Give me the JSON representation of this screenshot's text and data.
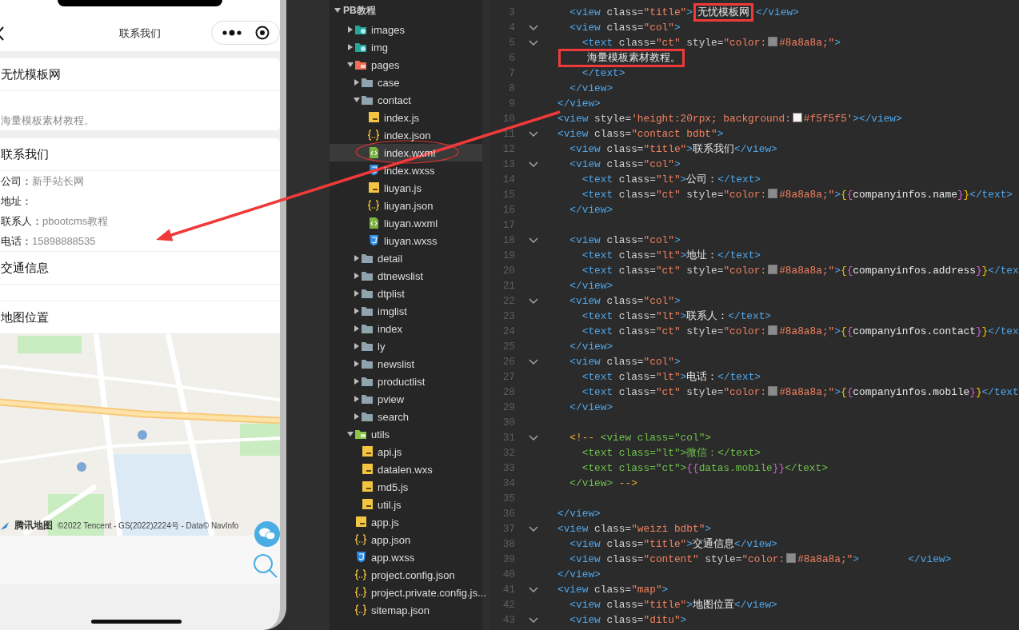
{
  "phone": {
    "nav_title": "联系我们",
    "intro": {
      "title": "无忧模板网",
      "text": "海量模板素材教程。"
    },
    "contact": {
      "title": "联系我们",
      "rows": [
        {
          "label": "公司：",
          "value": "新手站长网"
        },
        {
          "label": "地址："
        },
        {
          "label": "联系人：",
          "value": "pbootcms教程"
        },
        {
          "label": "电话：",
          "value": "15898888535"
        }
      ]
    },
    "traffic": {
      "title": "交通信息"
    },
    "map_section": {
      "title": "地图位置",
      "map": {
        "kind": "picture",
        "logo": "腾讯地图",
        "attribution": "©2022 Tencent - GS(2022)2224号 - Data© NavInfo"
      }
    }
  },
  "file_tree": {
    "title": "PB教程",
    "expanded": true,
    "items": [
      {
        "label": "images",
        "kind": "assets",
        "expanded": false,
        "selected": false
      },
      {
        "label": "img",
        "kind": "assets",
        "expanded": false,
        "selected": false
      },
      {
        "label": "pages",
        "kind": "pages",
        "expanded": true,
        "selected": false,
        "children": [
          {
            "label": "case",
            "kind": "folder",
            "expanded": false,
            "selected": false
          },
          {
            "label": "contact",
            "kind": "folder",
            "expanded": true,
            "selected": false,
            "children": [
              {
                "label": "index.js",
                "kind": "js",
                "selected": false
              },
              {
                "label": "index.json",
                "kind": "json",
                "selected": false
              },
              {
                "label": "index.wxml",
                "kind": "wxml",
                "selected": true
              },
              {
                "label": "index.wxss",
                "kind": "wxss",
                "selected": false
              },
              {
                "label": "liuyan.js",
                "kind": "js",
                "selected": false
              },
              {
                "label": "liuyan.json",
                "kind": "json",
                "selected": false
              },
              {
                "label": "liuyan.wxml",
                "kind": "wxml",
                "selected": false
              },
              {
                "label": "liuyan.wxss",
                "kind": "wxss",
                "selected": false
              }
            ]
          },
          {
            "label": "detail",
            "kind": "folder",
            "expanded": false,
            "selected": false
          },
          {
            "label": "dtnewslist",
            "kind": "folder",
            "expanded": false,
            "selected": false
          },
          {
            "label": "dtplist",
            "kind": "folder",
            "expanded": false,
            "selected": false
          },
          {
            "label": "imglist",
            "kind": "folder",
            "expanded": false,
            "selected": false
          },
          {
            "label": "index",
            "kind": "folder",
            "expanded": false,
            "selected": false
          },
          {
            "label": "ly",
            "kind": "folder",
            "expanded": false,
            "selected": false
          },
          {
            "label": "newslist",
            "kind": "folder",
            "expanded": false,
            "selected": false
          },
          {
            "label": "productlist",
            "kind": "folder",
            "expanded": false,
            "selected": false
          },
          {
            "label": "pview",
            "kind": "folder",
            "expanded": false,
            "selected": false
          },
          {
            "label": "search",
            "kind": "folder",
            "expanded": false,
            "selected": false
          }
        ]
      },
      {
        "label": "utils",
        "kind": "utils",
        "expanded": true,
        "selected": false,
        "children": [
          {
            "label": "api.js",
            "kind": "js",
            "selected": false
          },
          {
            "label": "datalen.wxs",
            "kind": "js",
            "selected": false
          },
          {
            "label": "md5.js",
            "kind": "js",
            "selected": false
          },
          {
            "label": "util.js",
            "kind": "js",
            "selected": false
          }
        ]
      },
      {
        "label": "app.js",
        "kind": "js",
        "selected": false
      },
      {
        "label": "app.json",
        "kind": "json",
        "selected": false
      },
      {
        "label": "app.wxss",
        "kind": "wxss",
        "selected": false
      },
      {
        "label": "project.config.json",
        "kind": "json",
        "selected": false
      },
      {
        "label": "project.private.config.js...",
        "kind": "json",
        "selected": false
      },
      {
        "label": "sitemap.json",
        "kind": "json",
        "selected": false
      }
    ]
  },
  "editor": {
    "lines": [
      {
        "number": "3",
        "fold": false,
        "tokens": [
          {
            "kind": "tag",
            "text": "  <view"
          },
          {
            "kind": "attr",
            "text": " class="
          },
          {
            "kind": "string",
            "text": "\"title\""
          },
          {
            "kind": "tag",
            "text": ">"
          },
          {
            "kind": "text",
            "text": "无忧模板网",
            "highlighted": true
          },
          {
            "kind": "tag",
            "text": "</view>"
          }
        ]
      },
      {
        "number": "4",
        "fold": true,
        "tokens": [
          {
            "kind": "tag",
            "text": "  <view"
          },
          {
            "kind": "attr",
            "text": " class="
          },
          {
            "kind": "string",
            "text": "\"col\""
          },
          {
            "kind": "tag",
            "text": ">"
          }
        ]
      },
      {
        "number": "5",
        "fold": true,
        "tokens": [
          {
            "kind": "tag",
            "text": "    <text"
          },
          {
            "kind": "attr",
            "text": " class="
          },
          {
            "kind": "string",
            "text": "\"ct\""
          },
          {
            "kind": "attr",
            "text": " style="
          },
          {
            "kind": "string",
            "text": "\"color:"
          },
          {
            "kind": "swatch",
            "color": "#8a8a8a"
          },
          {
            "kind": "string",
            "text": "#8a8a8a;\""
          },
          {
            "kind": "tag",
            "text": ">"
          }
        ]
      },
      {
        "number": "6",
        "fold": false,
        "tokens": [
          {
            "kind": "text",
            "text": "    海量模板素材教程。",
            "highlighted": true
          }
        ]
      },
      {
        "number": "7",
        "fold": false,
        "tokens": [
          {
            "kind": "tag",
            "text": "    </text>"
          }
        ]
      },
      {
        "number": "8",
        "fold": false,
        "tokens": [
          {
            "kind": "tag",
            "text": "  </view>"
          }
        ]
      },
      {
        "number": "9",
        "fold": false,
        "tokens": [
          {
            "kind": "tag",
            "text": "</view>"
          }
        ]
      },
      {
        "number": "10",
        "fold": false,
        "tokens": [
          {
            "kind": "tag",
            "text": "<view"
          },
          {
            "kind": "attr",
            "text": " style="
          },
          {
            "kind": "string",
            "text": "'height:20rpx; background:"
          },
          {
            "kind": "swatch",
            "color": "#f5f5f5"
          },
          {
            "kind": "string",
            "text": "#f5f5f5'"
          },
          {
            "kind": "tag",
            "text": "></view>"
          }
        ]
      },
      {
        "number": "11",
        "fold": true,
        "tokens": [
          {
            "kind": "tag",
            "text": "<view"
          },
          {
            "kind": "attr",
            "text": " class="
          },
          {
            "kind": "string",
            "text": "\"contact bdbt\""
          },
          {
            "kind": "tag",
            "text": ">"
          }
        ]
      },
      {
        "number": "12",
        "fold": false,
        "tokens": [
          {
            "kind": "tag",
            "text": "  <view"
          },
          {
            "kind": "attr",
            "text": " class="
          },
          {
            "kind": "string",
            "text": "\"title\""
          },
          {
            "kind": "tag",
            "text": ">"
          },
          {
            "kind": "text",
            "text": "联系我们"
          },
          {
            "kind": "tag",
            "text": "</view>"
          }
        ]
      },
      {
        "number": "13",
        "fold": true,
        "tokens": [
          {
            "kind": "tag",
            "text": "  <view"
          },
          {
            "kind": "attr",
            "text": " class="
          },
          {
            "kind": "string",
            "text": "\"col\""
          },
          {
            "kind": "tag",
            "text": ">"
          }
        ]
      },
      {
        "number": "14",
        "fold": false,
        "tokens": [
          {
            "kind": "tag",
            "text": "    <text"
          },
          {
            "kind": "attr",
            "text": " class="
          },
          {
            "kind": "string",
            "text": "\"lt\""
          },
          {
            "kind": "tag",
            "text": ">"
          },
          {
            "kind": "text",
            "text": "公司："
          },
          {
            "kind": "tag",
            "text": "</text>"
          }
        ]
      },
      {
        "number": "15",
        "fold": false,
        "tokens": [
          {
            "kind": "tag",
            "text": "    <text"
          },
          {
            "kind": "attr",
            "text": " class="
          },
          {
            "kind": "string",
            "text": "\"ct\""
          },
          {
            "kind": "attr",
            "text": " style="
          },
          {
            "kind": "string",
            "text": "\"color:"
          },
          {
            "kind": "swatch",
            "color": "#8a8a8a"
          },
          {
            "kind": "string",
            "text": "#8a8a8a;\""
          },
          {
            "kind": "tag",
            "text": ">"
          },
          {
            "kind": "brace",
            "text": "{"
          },
          {
            "kind": "brace2",
            "text": "{"
          },
          {
            "kind": "text",
            "text": "companyinfos.name"
          },
          {
            "kind": "brace2",
            "text": "}"
          },
          {
            "kind": "brace",
            "text": "}"
          },
          {
            "kind": "tag",
            "text": "</text>"
          }
        ]
      },
      {
        "number": "16",
        "fold": false,
        "tokens": [
          {
            "kind": "tag",
            "text": "  </view>"
          }
        ]
      },
      {
        "number": "17",
        "fold": false
      },
      {
        "number": "18",
        "fold": true,
        "tokens": [
          {
            "kind": "tag",
            "text": "  <view"
          },
          {
            "kind": "attr",
            "text": " class="
          },
          {
            "kind": "string",
            "text": "\"col\""
          },
          {
            "kind": "tag",
            "text": ">"
          }
        ]
      },
      {
        "number": "19",
        "fold": false,
        "tokens": [
          {
            "kind": "tag",
            "text": "    <text"
          },
          {
            "kind": "attr",
            "text": " class="
          },
          {
            "kind": "string",
            "text": "\"lt\""
          },
          {
            "kind": "tag",
            "text": ">"
          },
          {
            "kind": "text",
            "text": "地址："
          },
          {
            "kind": "tag",
            "text": "</text>"
          }
        ]
      },
      {
        "number": "20",
        "fold": false,
        "tokens": [
          {
            "kind": "tag",
            "text": "    <text"
          },
          {
            "kind": "attr",
            "text": " class="
          },
          {
            "kind": "string",
            "text": "\"ct\""
          },
          {
            "kind": "attr",
            "text": " style="
          },
          {
            "kind": "string",
            "text": "\"color:"
          },
          {
            "kind": "swatch",
            "color": "#8a8a8a"
          },
          {
            "kind": "string",
            "text": "#8a8a8a;\""
          },
          {
            "kind": "tag",
            "text": ">"
          },
          {
            "kind": "brace",
            "text": "{"
          },
          {
            "kind": "brace2",
            "text": "{"
          },
          {
            "kind": "text",
            "text": "companyinfos.address"
          },
          {
            "kind": "brace2",
            "text": "}"
          },
          {
            "kind": "brace",
            "text": "}"
          },
          {
            "kind": "tag",
            "text": "</tex"
          }
        ]
      },
      {
        "number": "21",
        "fold": false,
        "tokens": [
          {
            "kind": "tag",
            "text": "  </view>"
          }
        ]
      },
      {
        "number": "22",
        "fold": true,
        "tokens": [
          {
            "kind": "tag",
            "text": "  <view"
          },
          {
            "kind": "attr",
            "text": " class="
          },
          {
            "kind": "string",
            "text": "\"col\""
          },
          {
            "kind": "tag",
            "text": ">"
          }
        ]
      },
      {
        "number": "23",
        "fold": false,
        "tokens": [
          {
            "kind": "tag",
            "text": "    <text"
          },
          {
            "kind": "attr",
            "text": " class="
          },
          {
            "kind": "string",
            "text": "\"lt\""
          },
          {
            "kind": "tag",
            "text": ">"
          },
          {
            "kind": "text",
            "text": "联系人："
          },
          {
            "kind": "tag",
            "text": "</text>"
          }
        ]
      },
      {
        "number": "24",
        "fold": false,
        "tokens": [
          {
            "kind": "tag",
            "text": "    <text"
          },
          {
            "kind": "attr",
            "text": " class="
          },
          {
            "kind": "string",
            "text": "\"ct\""
          },
          {
            "kind": "attr",
            "text": " style="
          },
          {
            "kind": "string",
            "text": "\"color:"
          },
          {
            "kind": "swatch",
            "color": "#8a8a8a"
          },
          {
            "kind": "string",
            "text": "#8a8a8a;\""
          },
          {
            "kind": "tag",
            "text": ">"
          },
          {
            "kind": "brace",
            "text": "{"
          },
          {
            "kind": "brace2",
            "text": "{"
          },
          {
            "kind": "text",
            "text": "companyinfos.contact"
          },
          {
            "kind": "brace2",
            "text": "}"
          },
          {
            "kind": "brace",
            "text": "}"
          },
          {
            "kind": "tag",
            "text": "</tex"
          }
        ]
      },
      {
        "number": "25",
        "fold": false,
        "tokens": [
          {
            "kind": "tag",
            "text": "  </view>"
          }
        ]
      },
      {
        "number": "26",
        "fold": true,
        "tokens": [
          {
            "kind": "tag",
            "text": "  <view"
          },
          {
            "kind": "attr",
            "text": " class="
          },
          {
            "kind": "string",
            "text": "\"col\""
          },
          {
            "kind": "tag",
            "text": ">"
          }
        ]
      },
      {
        "number": "27",
        "fold": false,
        "tokens": [
          {
            "kind": "tag",
            "text": "    <text"
          },
          {
            "kind": "attr",
            "text": " class="
          },
          {
            "kind": "string",
            "text": "\"lt\""
          },
          {
            "kind": "tag",
            "text": ">"
          },
          {
            "kind": "text",
            "text": "电话："
          },
          {
            "kind": "tag",
            "text": "</text>"
          }
        ]
      },
      {
        "number": "28",
        "fold": false,
        "tokens": [
          {
            "kind": "tag",
            "text": "    <text"
          },
          {
            "kind": "attr",
            "text": " class="
          },
          {
            "kind": "string",
            "text": "\"ct\""
          },
          {
            "kind": "attr",
            "text": " style="
          },
          {
            "kind": "string",
            "text": "\"color:"
          },
          {
            "kind": "swatch",
            "color": "#8a8a8a"
          },
          {
            "kind": "string",
            "text": "#8a8a8a;\""
          },
          {
            "kind": "tag",
            "text": ">"
          },
          {
            "kind": "brace",
            "text": "{"
          },
          {
            "kind": "brace2",
            "text": "{"
          },
          {
            "kind": "text",
            "text": "companyinfos.mobile"
          },
          {
            "kind": "brace2",
            "text": "}"
          },
          {
            "kind": "brace",
            "text": "}"
          },
          {
            "kind": "tag",
            "text": "</text"
          }
        ]
      },
      {
        "number": "29",
        "fold": false,
        "tokens": [
          {
            "kind": "tag",
            "text": "  </view>"
          }
        ]
      },
      {
        "number": "30",
        "fold": false
      },
      {
        "number": "31",
        "fold": true,
        "tokens": [
          {
            "kind": "mark",
            "text": "  <!--"
          },
          {
            "kind": "comment",
            "text": " <view class=\"col\">"
          }
        ]
      },
      {
        "number": "32",
        "fold": false,
        "tokens": [
          {
            "kind": "comment",
            "text": "    <text class=\"lt\">微信：</text>"
          }
        ]
      },
      {
        "number": "33",
        "fold": false,
        "tokens": [
          {
            "kind": "comment",
            "text": "    <text class=\"ct\">"
          },
          {
            "kind": "brace2",
            "text": "{{"
          },
          {
            "kind": "comment",
            "text": "datas.mobile"
          },
          {
            "kind": "brace2",
            "text": "}}"
          },
          {
            "kind": "comment",
            "text": "</text>"
          }
        ]
      },
      {
        "number": "34",
        "fold": false,
        "tokens": [
          {
            "kind": "comment",
            "text": "  </view>"
          },
          {
            "kind": "mark",
            "text": " -->"
          }
        ]
      },
      {
        "number": "35",
        "fold": false
      },
      {
        "number": "36",
        "fold": false,
        "tokens": [
          {
            "kind": "tag",
            "text": "</view>"
          }
        ]
      },
      {
        "number": "37",
        "fold": true,
        "tokens": [
          {
            "kind": "tag",
            "text": "<view"
          },
          {
            "kind": "attr",
            "text": " class="
          },
          {
            "kind": "string",
            "text": "\"weizi bdbt\""
          },
          {
            "kind": "tag",
            "text": ">"
          }
        ]
      },
      {
        "number": "38",
        "fold": false,
        "tokens": [
          {
            "kind": "tag",
            "text": "  <view"
          },
          {
            "kind": "attr",
            "text": " class="
          },
          {
            "kind": "string",
            "text": "\"title\""
          },
          {
            "kind": "tag",
            "text": ">"
          },
          {
            "kind": "text",
            "text": "交通信息"
          },
          {
            "kind": "tag",
            "text": "</view>"
          }
        ]
      },
      {
        "number": "39",
        "fold": false,
        "tokens": [
          {
            "kind": "tag",
            "text": "  <view"
          },
          {
            "kind": "attr",
            "text": " class="
          },
          {
            "kind": "string",
            "text": "\"content\""
          },
          {
            "kind": "attr",
            "text": " style="
          },
          {
            "kind": "string",
            "text": "\"color:"
          },
          {
            "kind": "swatch",
            "color": "#8a8a8a"
          },
          {
            "kind": "string",
            "text": "#8a8a8a;\""
          },
          {
            "kind": "tag",
            "text": ">        </view>"
          }
        ]
      },
      {
        "number": "40",
        "fold": false,
        "tokens": [
          {
            "kind": "tag",
            "text": "</view>"
          }
        ]
      },
      {
        "number": "41",
        "fold": true,
        "tokens": [
          {
            "kind": "tag",
            "text": "<view"
          },
          {
            "kind": "attr",
            "text": " class="
          },
          {
            "kind": "string",
            "text": "\"map\""
          },
          {
            "kind": "tag",
            "text": ">"
          }
        ]
      },
      {
        "number": "42",
        "fold": false,
        "tokens": [
          {
            "kind": "tag",
            "text": "  <view"
          },
          {
            "kind": "attr",
            "text": " class="
          },
          {
            "kind": "string",
            "text": "\"title\""
          },
          {
            "kind": "tag",
            "text": ">"
          },
          {
            "kind": "text",
            "text": "地图位置"
          },
          {
            "kind": "tag",
            "text": "</view>"
          }
        ]
      },
      {
        "number": "43",
        "fold": true,
        "tokens": [
          {
            "kind": "tag",
            "text": "  <view"
          },
          {
            "kind": "attr",
            "text": " class="
          },
          {
            "kind": "string",
            "text": "\"ditu\""
          },
          {
            "kind": "tag",
            "text": ">"
          }
        ]
      }
    ]
  }
}
